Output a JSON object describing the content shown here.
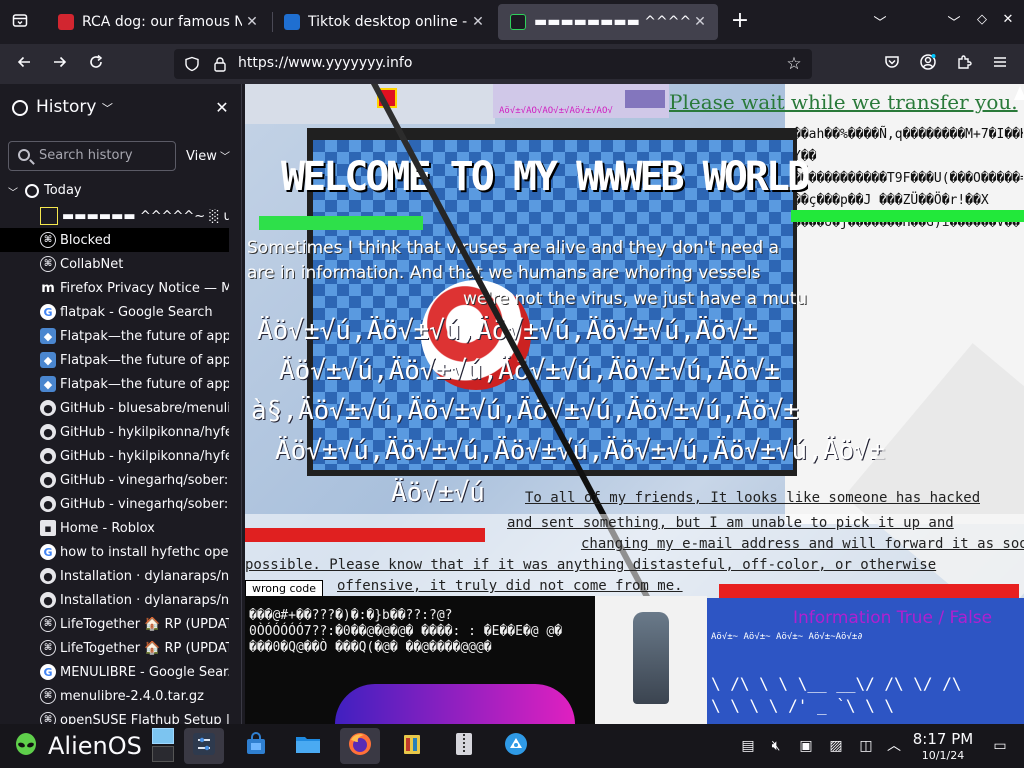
{
  "tabs": [
    {
      "title": "RCA dog: our famous Nipp",
      "favicon": "rca-icon",
      "active": false
    },
    {
      "title": "Tiktok desktop online - Run",
      "favicon": "tiktok-icon",
      "active": false
    },
    {
      "title": "▬▬▬▬▬▬▬▬ ^^^^^~ ░ ui▀▄",
      "favicon": "glitch-icon",
      "active": true
    }
  ],
  "toolbar": {
    "url": "https://www.yyyyyyy.info"
  },
  "sidebar": {
    "title": "History",
    "search_placeholder": "Search history",
    "view_label": "View",
    "group_label": "Today",
    "items": [
      {
        "label": "▬▬▬▬▬▬ ^^^^^~ ░ ui▀▄",
        "icon": "square-icon"
      },
      {
        "label": "Blocked",
        "icon": "globe-icon"
      },
      {
        "label": "CollabNet",
        "icon": "globe-icon"
      },
      {
        "label": "Firefox Privacy Notice — M",
        "icon": "mozilla-icon"
      },
      {
        "label": "flatpak - Google Search",
        "icon": "google-icon"
      },
      {
        "label": "Flatpak—the future of app.",
        "icon": "flatpak-icon"
      },
      {
        "label": "Flatpak—the future of app.",
        "icon": "flatpak-icon"
      },
      {
        "label": "Flatpak—the future of app.",
        "icon": "flatpak-icon"
      },
      {
        "label": "GitHub - bluesabre/menuli.",
        "icon": "github-icon"
      },
      {
        "label": "GitHub - hykilpikonna/hyfe",
        "icon": "github-icon"
      },
      {
        "label": "GitHub - hykilpikonna/hyfe",
        "icon": "github-icon"
      },
      {
        "label": "GitHub - vinegarhq/sober:",
        "icon": "github-icon"
      },
      {
        "label": "GitHub - vinegarhq/sober:",
        "icon": "github-icon"
      },
      {
        "label": "Home - Roblox",
        "icon": "roblox-icon"
      },
      {
        "label": "how to install hyfethc ope..",
        "icon": "google-icon"
      },
      {
        "label": "Installation · dylanaraps/n.",
        "icon": "github-icon"
      },
      {
        "label": "Installation · dylanaraps/n.",
        "icon": "github-icon"
      },
      {
        "label": "LifeTogether 🏠 RP (UPDAT.",
        "icon": "globe-icon"
      },
      {
        "label": "LifeTogether 🏠 RP (UPDAT.",
        "icon": "globe-icon"
      },
      {
        "label": "MENULIBRE - Google Sear..",
        "icon": "google-icon"
      },
      {
        "label": "menulibre-2.4.0.tar.gz",
        "icon": "globe-icon"
      },
      {
        "label": "openSUSE Flathub Setup |",
        "icon": "globe-icon"
      }
    ]
  },
  "page": {
    "welcome_title": "WELCOME TO MY  WWWEB WORLD",
    "wait_text": "Please wait while we transfer you.",
    "virus_line1": "Sometimes I think that viruses are alive and they don't need a",
    "virus_line2": "are in information. And that we humans are whoring vessels",
    "virus_line3": "we're not the virus, we just have a mutu",
    "garble_rows": [
      "Äö√±√ú,Äö√±√ú,Äö√±√ú,Äö√±√ú,Äö√±",
      "Äö√±√ú,Äö√±√ú,Äö√±√ú,Äö√±√ú,Äö√±",
      "à§,Äö√±√ú,Äö√±√ú,Äö√±√ú,Äö√±√ú,Äö√±",
      "Äö√±√ú,Äö√±√ú,Äö√±√ú,Äö√±√ú,Äö√±√ú,Äö√±",
      "Äö√±√ú"
    ],
    "hack_line1": "To all of my friends, It looks like someone has hacked",
    "hack_line2": "and sent something, but I am unable to pick it up and",
    "hack_line3": "changing my e-mail address and will forward it as soon as",
    "hack_line4": "possible. Please know that if it was anything distasteful, off-color, or otherwise",
    "hack_line5": "offensive, it truly did not come from me.",
    "wrong_code": "wrong code",
    "info_true": "Information True / False",
    "ascii_row1": "\\ /\\  \\  \\  \\__  __\\/ /\\   \\/ /\\",
    "ascii_row2": " \\  \\  \\  \\ /'  _ `\\ \\  \\",
    "mojibake_small": "Äö√±√ú,Äö√±√ú,Äö√±√ú,Äö√±√ú,Äö√±",
    "pink_bar_text": "Äö√±~ Äö√±~ Äö√±~ Äö√±~Äö√±∂"
  },
  "taskbar": {
    "os_label": "AlienOS",
    "time": "8:17 PM",
    "date": "10/1/24"
  }
}
